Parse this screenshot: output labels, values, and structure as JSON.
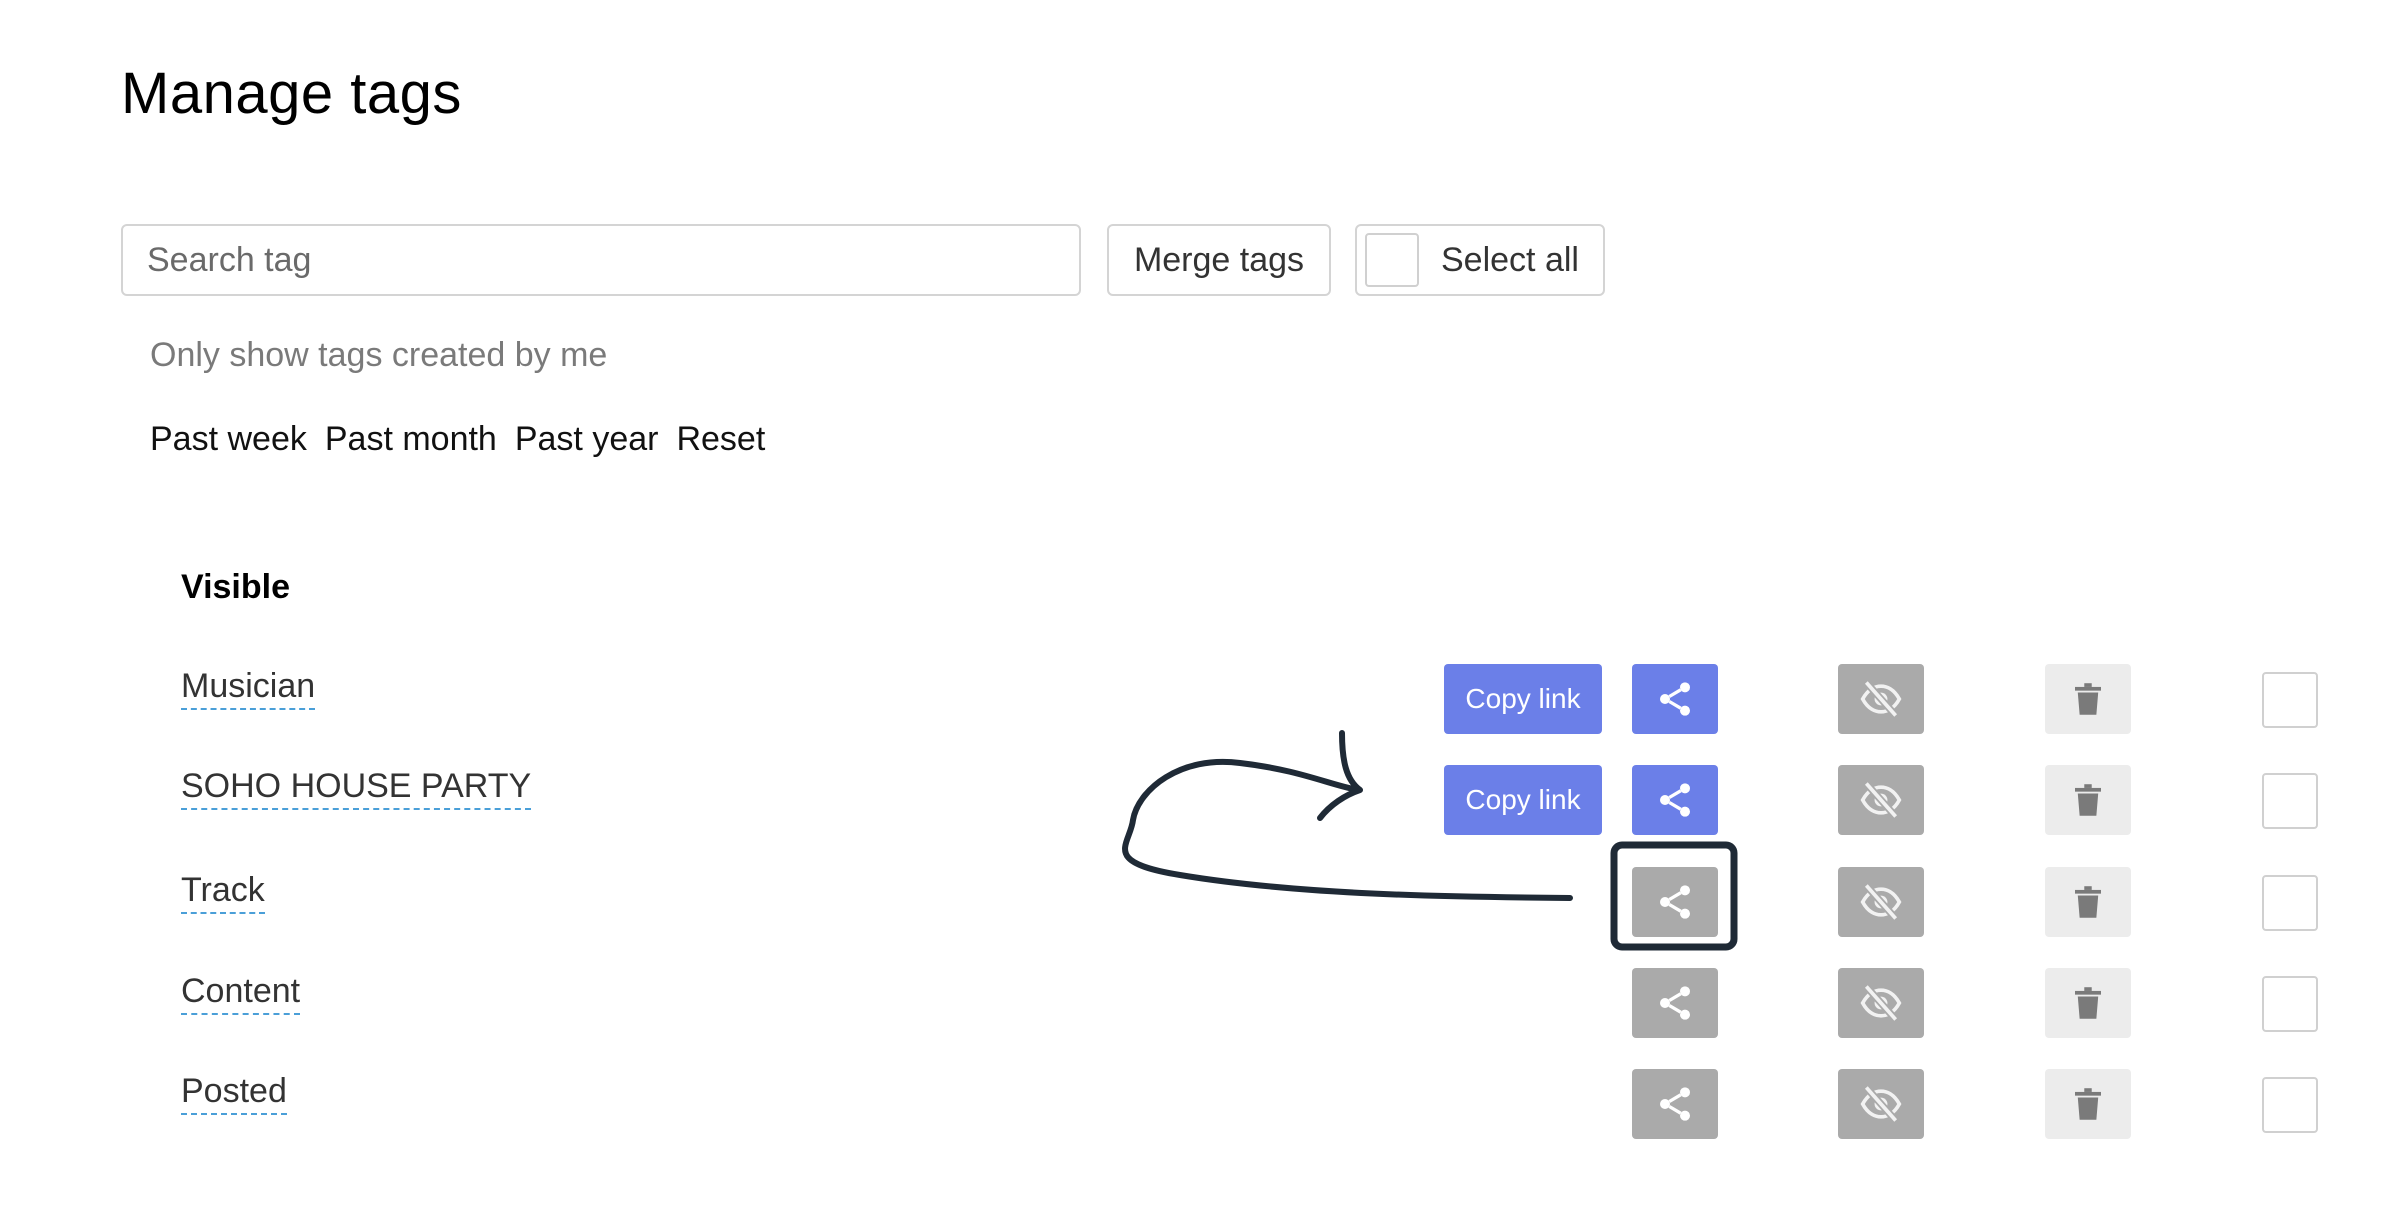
{
  "page": {
    "title": "Manage tags"
  },
  "toolbar": {
    "search_placeholder": "Search tag",
    "merge_label": "Merge tags",
    "select_all_label": "Select all"
  },
  "filters": {
    "only_mine": "Only show tags created by me",
    "ranges": [
      "Past week",
      "Past month",
      "Past year",
      "Reset"
    ]
  },
  "section": {
    "title": "Visible"
  },
  "buttons": {
    "copy_link": "Copy link"
  },
  "tags": [
    {
      "name": "Musician",
      "shared": true
    },
    {
      "name": "SOHO HOUSE PARTY",
      "shared": true
    },
    {
      "name": "Track",
      "shared": false
    },
    {
      "name": "Content",
      "shared": false
    },
    {
      "name": "Posted",
      "shared": false
    }
  ],
  "icons": {
    "share": "share-icon",
    "hide": "eye-slash-icon",
    "delete": "trash-icon"
  },
  "colors": {
    "accent": "#6b7fe8",
    "inactive_button": "#aaaaaa",
    "trash_bg": "#ececec",
    "link_underline": "#4a9fd8",
    "annotation": "#1f2a36"
  }
}
